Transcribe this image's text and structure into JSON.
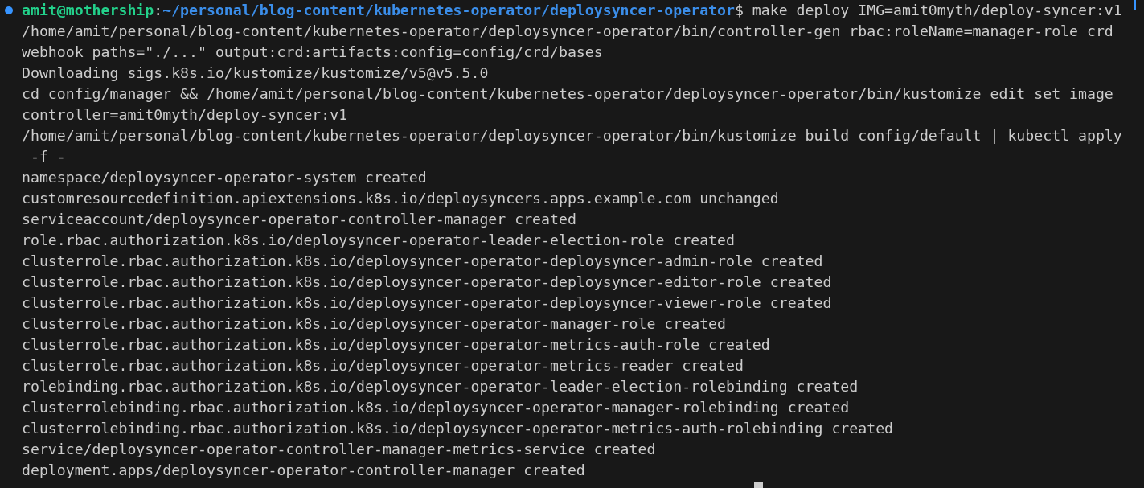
{
  "terminal": {
    "lines": [
      {
        "kind": "prompt",
        "user": "amit@mothership",
        "separator": ":",
        "path": "~/personal/blog-content/kubernetes-operator/deploysyncer-operator",
        "symbol": "$",
        "command": "make deploy IMG=amit0myth/deploy-syncer:v1"
      },
      {
        "kind": "output",
        "text": "/home/amit/personal/blog-content/kubernetes-operator/deploysyncer-operator/bin/controller-gen rbac:roleName=manager-role crd"
      },
      {
        "kind": "output",
        "text": "webhook paths=\"./...\" output:crd:artifacts:config=config/crd/bases"
      },
      {
        "kind": "output",
        "text": "Downloading sigs.k8s.io/kustomize/kustomize/v5@v5.5.0"
      },
      {
        "kind": "output",
        "text": "cd config/manager && /home/amit/personal/blog-content/kubernetes-operator/deploysyncer-operator/bin/kustomize edit set image"
      },
      {
        "kind": "output",
        "text": "controller=amit0myth/deploy-syncer:v1"
      },
      {
        "kind": "output",
        "text": "/home/amit/personal/blog-content/kubernetes-operator/deploysyncer-operator/bin/kustomize build config/default | kubectl apply"
      },
      {
        "kind": "output",
        "text": " -f -"
      },
      {
        "kind": "output",
        "text": "namespace/deploysyncer-operator-system created"
      },
      {
        "kind": "output",
        "text": "customresourcedefinition.apiextensions.k8s.io/deploysyncers.apps.example.com unchanged"
      },
      {
        "kind": "output",
        "text": "serviceaccount/deploysyncer-operator-controller-manager created"
      },
      {
        "kind": "output",
        "text": "role.rbac.authorization.k8s.io/deploysyncer-operator-leader-election-role created"
      },
      {
        "kind": "output",
        "text": "clusterrole.rbac.authorization.k8s.io/deploysyncer-operator-deploysyncer-admin-role created"
      },
      {
        "kind": "output",
        "text": "clusterrole.rbac.authorization.k8s.io/deploysyncer-operator-deploysyncer-editor-role created"
      },
      {
        "kind": "output",
        "text": "clusterrole.rbac.authorization.k8s.io/deploysyncer-operator-deploysyncer-viewer-role created"
      },
      {
        "kind": "output",
        "text": "clusterrole.rbac.authorization.k8s.io/deploysyncer-operator-manager-role created"
      },
      {
        "kind": "output",
        "text": "clusterrole.rbac.authorization.k8s.io/deploysyncer-operator-metrics-auth-role created"
      },
      {
        "kind": "output",
        "text": "clusterrole.rbac.authorization.k8s.io/deploysyncer-operator-metrics-reader created"
      },
      {
        "kind": "output",
        "text": "rolebinding.rbac.authorization.k8s.io/deploysyncer-operator-leader-election-rolebinding created"
      },
      {
        "kind": "output",
        "text": "clusterrolebinding.rbac.authorization.k8s.io/deploysyncer-operator-manager-rolebinding created"
      },
      {
        "kind": "output",
        "text": "clusterrolebinding.rbac.authorization.k8s.io/deploysyncer-operator-metrics-auth-rolebinding created"
      },
      {
        "kind": "output",
        "text": "service/deploysyncer-operator-controller-manager-metrics-service created"
      },
      {
        "kind": "output",
        "text": "deployment.apps/deploysyncer-operator-controller-manager created"
      },
      {
        "kind": "cursor"
      }
    ]
  }
}
